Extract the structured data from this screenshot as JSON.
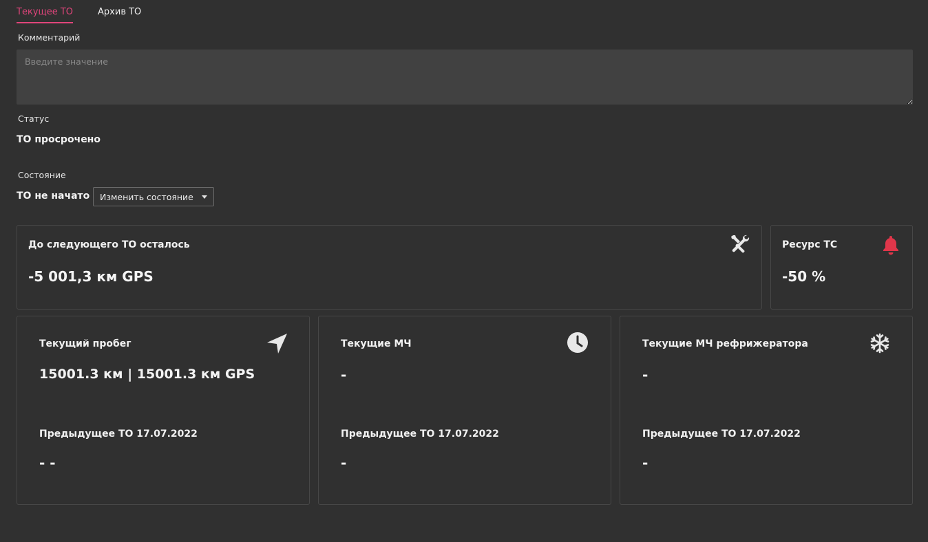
{
  "tabs": [
    {
      "label": "Текущее ТО",
      "active": true
    },
    {
      "label": "Архив ТО",
      "active": false
    }
  ],
  "comment": {
    "label": "Комментарий",
    "placeholder": "Введите значение",
    "value": ""
  },
  "status": {
    "label": "Статус",
    "value": "ТО просрочено"
  },
  "state": {
    "label": "Состояние",
    "value": "ТО не начато",
    "change_label": "Изменить состояние"
  },
  "next_service": {
    "title": "До следующего ТО осталось",
    "value": "-5 001,3 км GPS",
    "icon": "tools-icon"
  },
  "resource": {
    "title": "Ресурс ТС",
    "value": "-50 %",
    "icon": "bell-icon",
    "icon_color": "#e0364a"
  },
  "mileage": {
    "title": "Текущий пробег",
    "value": "15001.3 км | 15001.3 км GPS",
    "icon": "navigation-arrow-icon",
    "prev_label": "Предыдущее ТО 17.07.2022",
    "prev_value": "- -"
  },
  "engine_hours": {
    "title": "Текущие МЧ",
    "value": "-",
    "icon": "clock-icon",
    "prev_label": "Предыдущее ТО 17.07.2022",
    "prev_value": "-"
  },
  "fridge_hours": {
    "title": "Текущие МЧ рефрижератора",
    "value": "-",
    "icon": "snowflake-icon",
    "prev_label": "Предыдущее ТО 17.07.2022",
    "prev_value": "-"
  },
  "colors": {
    "accent": "#e0457b",
    "background": "#303030",
    "alert": "#e0364a"
  }
}
